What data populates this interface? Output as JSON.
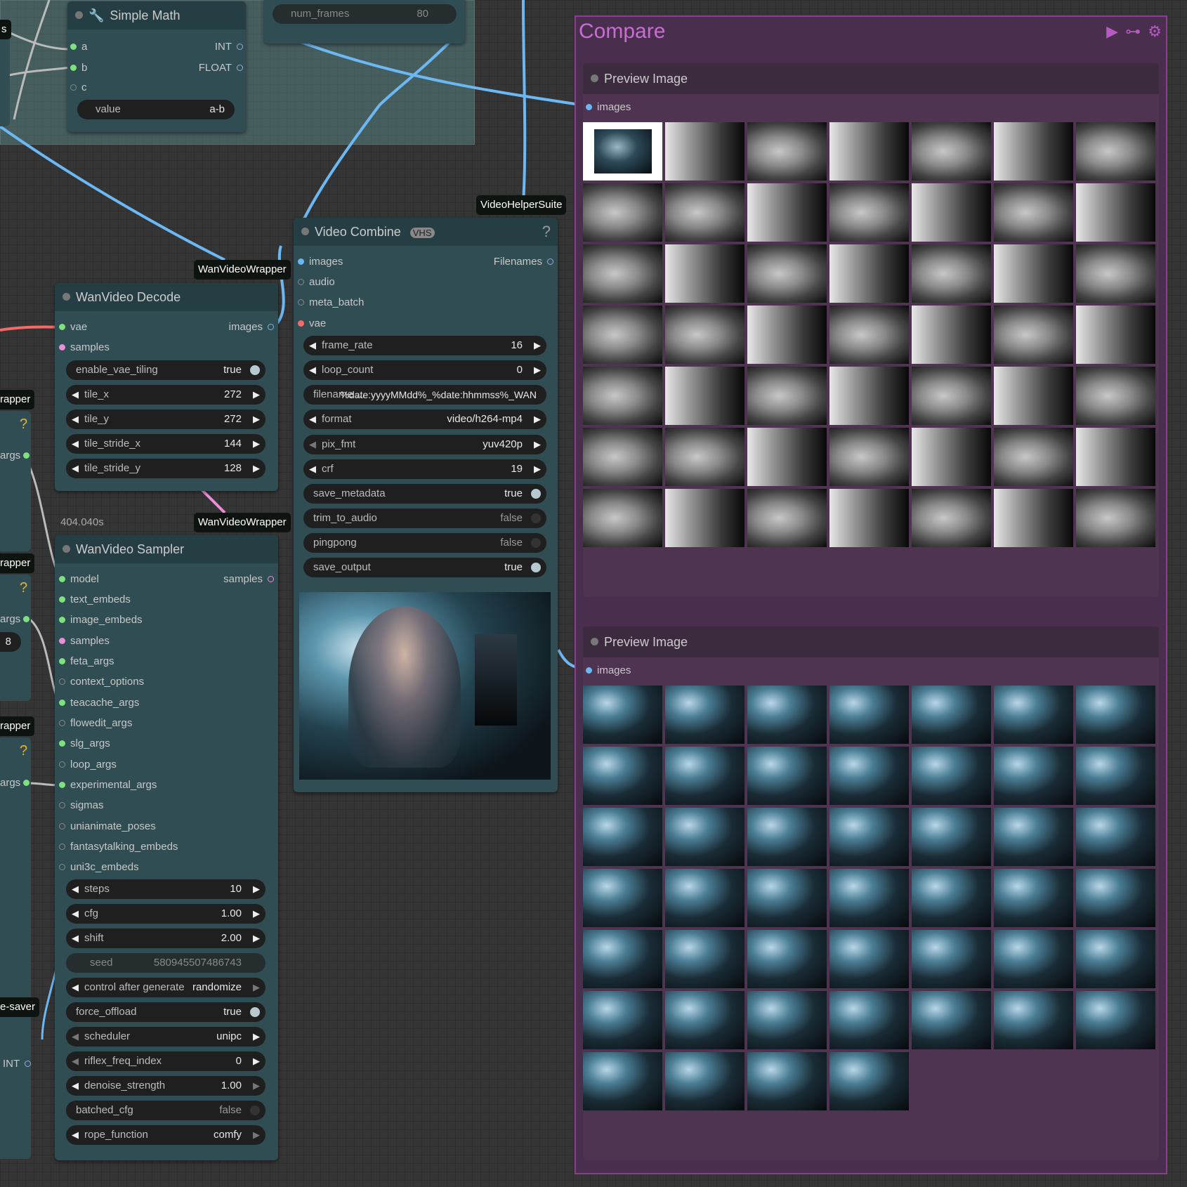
{
  "simple_math": {
    "title": "Simple Math",
    "inputs": [
      "a",
      "b",
      "c"
    ],
    "outputs": [
      "INT",
      "FLOAT"
    ],
    "widget": {
      "label": "value",
      "value": "a-b"
    }
  },
  "top_partial": {
    "label": "num_frames",
    "value": "80"
  },
  "decode": {
    "tag": "WanVideoWrapper",
    "title": "WanVideo Decode",
    "inputs": [
      "vae",
      "samples"
    ],
    "output": "images",
    "widgets": [
      {
        "label": "enable_vae_tiling",
        "value": "true"
      },
      {
        "label": "tile_x",
        "value": "272"
      },
      {
        "label": "tile_y",
        "value": "272"
      },
      {
        "label": "tile_stride_x",
        "value": "144"
      },
      {
        "label": "tile_stride_y",
        "value": "128"
      }
    ]
  },
  "sampler": {
    "tag": "WanVideoWrapper",
    "time": "404.040s",
    "title": "WanVideo Sampler",
    "output": "samples",
    "inputs": [
      "model",
      "text_embeds",
      "image_embeds",
      "samples",
      "feta_args",
      "context_options",
      "teacache_args",
      "flowedit_args",
      "slg_args",
      "loop_args",
      "experimental_args",
      "sigmas",
      "unianimate_poses",
      "fantasytalking_embeds",
      "uni3c_embeds"
    ],
    "widgets": [
      {
        "label": "steps",
        "value": "10"
      },
      {
        "label": "cfg",
        "value": "1.00"
      },
      {
        "label": "shift",
        "value": "2.00"
      },
      {
        "label": "seed",
        "value": "580945507486743"
      },
      {
        "label": "control after generate",
        "value": "randomize"
      },
      {
        "label": "force_offload",
        "value": "true"
      },
      {
        "label": "scheduler",
        "value": "unipc"
      },
      {
        "label": "riflex_freq_index",
        "value": "0"
      },
      {
        "label": "denoise_strength",
        "value": "1.00"
      },
      {
        "label": "batched_cfg",
        "value": "false"
      },
      {
        "label": "rope_function",
        "value": "comfy"
      }
    ]
  },
  "combine": {
    "tag": "VideoHelperSuite",
    "title": "Video Combine",
    "badge": "VHS",
    "help": "?",
    "inputs": [
      "images",
      "audio",
      "meta_batch",
      "vae"
    ],
    "output": "Filenames",
    "widgets": [
      {
        "label": "frame_rate",
        "value": "16"
      },
      {
        "label": "loop_count",
        "value": "0"
      },
      {
        "label": "filename ...",
        "value": "%date:yyyyMMdd%_%date:hhmmss%_WAN"
      },
      {
        "label": "format",
        "value": "video/h264-mp4"
      },
      {
        "label": "pix_fmt",
        "value": "yuv420p"
      },
      {
        "label": "crf",
        "value": "19"
      },
      {
        "label": "save_metadata",
        "value": "true"
      },
      {
        "label": "trim_to_audio",
        "value": "false"
      },
      {
        "label": "pingpong",
        "value": "false"
      },
      {
        "label": "save_output",
        "value": "true"
      }
    ]
  },
  "left_partial": {
    "tags": [
      "rapper",
      "rapper",
      "rapper",
      "e-saver"
    ],
    "labels": [
      "args",
      "args",
      "args"
    ],
    "value8": "8",
    "int_label": "INT",
    "question": "?",
    "s_label": "s"
  },
  "compare": {
    "title": "Compare",
    "preview1": {
      "title": "Preview Image",
      "input": "images"
    },
    "preview2": {
      "title": "Preview Image",
      "input": "images"
    }
  },
  "colors": {
    "link_blue": "#6cb8f5",
    "link_pink": "#e98fd8",
    "link_red": "#f46a6a",
    "compare_bg": "#4a2e4e",
    "compare_title": "#c76ed0",
    "node_bg": "#2f4d52"
  }
}
